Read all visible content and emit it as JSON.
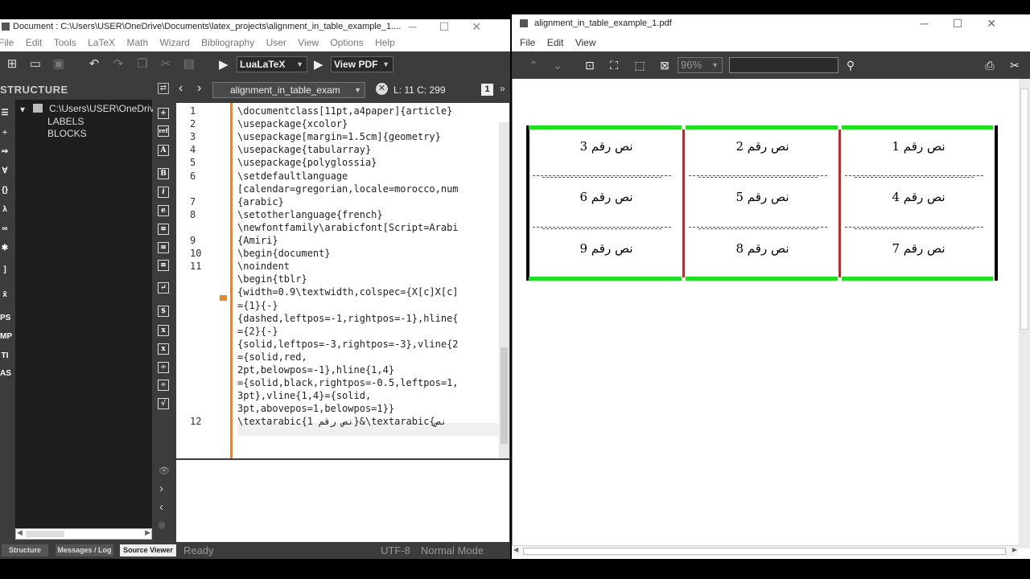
{
  "left_window": {
    "title": "Document : C:\\Users\\USER\\OneDrive\\Documents\\latex_projects\\alignment_in_table_example_1....",
    "menu": [
      "File",
      "Edit",
      "Tools",
      "LaTeX",
      "Math",
      "Wizard",
      "Bibliography",
      "User",
      "View",
      "Options",
      "Help"
    ],
    "compiler": "LuaLaTeX",
    "viewer": "View PDF",
    "structure_header": "STRUCTURE",
    "tree": {
      "root": "C:\\Users\\USER\\OneDrive",
      "items": [
        "LABELS",
        "BLOCKS"
      ]
    },
    "tab_label": "alignment_in_table_exam",
    "cursor_position": "L: 11 C: 299",
    "line_numbers": [
      "1",
      "2",
      "3",
      "4",
      "5",
      "6",
      "",
      "7",
      "8",
      "",
      "9",
      "10",
      "11",
      "",
      "",
      "",
      "",
      "",
      "",
      "",
      "",
      "",
      "12"
    ],
    "code_lines": [
      "\\documentclass[11pt,a4paper]{article}",
      "\\usepackage{xcolor}",
      "\\usepackage[margin=1.5cm]{geometry}",
      "\\usepackage{tabularray}",
      "\\usepackage{polyglossia}",
      "\\setdefaultlanguage",
      "[calendar=gregorian,locale=morocco,num",
      "{arabic}",
      "\\setotherlanguage{french}",
      "\\newfontfamily\\arabicfont[Script=Arabi",
      "{Amiri}",
      "\\begin{document}",
      "\\noindent",
      "\\begin{tblr}",
      "{width=0.9\\textwidth,colspec={X[c]X[c]",
      "={1}{-}",
      "{dashed,leftpos=-1,rightpos=-1},hline{",
      "={2}{-}",
      "{solid,leftpos=-3,rightpos=-3},vline{2",
      "={solid,red,",
      "2pt,belowpos=-1},hline{1,4}",
      "={solid,black,rightpos=-0.5,leftpos=1,",
      "3pt},vline{1,4}={solid,",
      "3pt,abovepos=1,belowpos=1}}",
      "\\textarabic{1 نص رقم}&\\textarabic{نص"
    ],
    "status": {
      "tabs": [
        "Structure",
        "Messages / Log",
        "Source Viewer"
      ],
      "ready": "Ready",
      "encoding": "UTF-8",
      "mode": "Normal Mode"
    }
  },
  "right_window": {
    "title": "alignment_in_table_example_1.pdf",
    "menu": [
      "File",
      "Edit",
      "View"
    ],
    "zoom": "96%",
    "table": {
      "rows": [
        [
          "نص رقم 1",
          "نص رقم 2",
          "نص رقم 3"
        ],
        [
          "نص رقم 4",
          "نص رقم 5",
          "نص رقم 6"
        ],
        [
          "نص رقم 7",
          "نص رقم 8",
          "نص رقم 9"
        ]
      ],
      "colors": {
        "hline": "#1fe01f",
        "inner_vline": "#c0282a",
        "outer_vline": "#000000"
      }
    }
  }
}
